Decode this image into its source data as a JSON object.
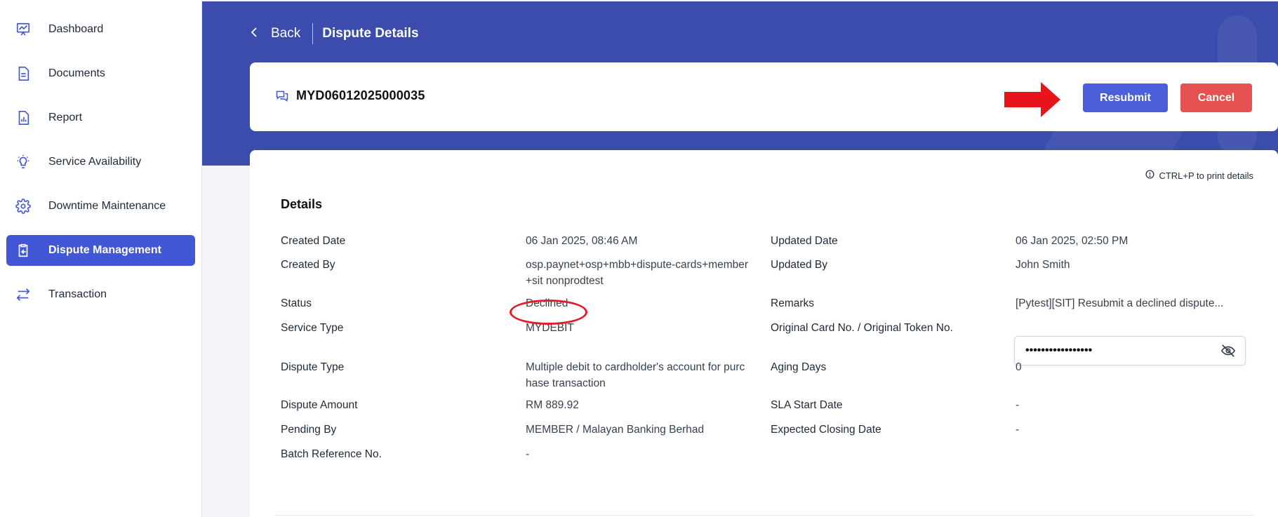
{
  "sidebar": {
    "items": [
      {
        "label": "Dashboard",
        "icon": "presentation-chart-icon"
      },
      {
        "label": "Documents",
        "icon": "document-icon"
      },
      {
        "label": "Report",
        "icon": "report-chart-icon"
      },
      {
        "label": "Service Availability",
        "icon": "lightbulb-icon"
      },
      {
        "label": "Downtime Maintenance",
        "icon": "gear-icon"
      },
      {
        "label": "Dispute Management",
        "icon": "clipboard-arrow-icon",
        "active": true
      },
      {
        "label": "Transaction",
        "icon": "arrows-exchange-icon"
      }
    ]
  },
  "header": {
    "back_label": "Back",
    "title": "Dispute Details"
  },
  "dispute": {
    "id": "MYD06012025000035",
    "resubmit_label": "Resubmit",
    "cancel_label": "Cancel"
  },
  "details": {
    "print_hint": "CTRL+P to print details",
    "title": "Details",
    "left": [
      {
        "label": "Created Date",
        "value": "06 Jan 2025, 08:46 AM"
      },
      {
        "label": "Created By",
        "value": "osp.paynet+osp+mbb+dispute-cards+member",
        "value2": "+sit nonprodtest"
      },
      {
        "label": "Status",
        "value": "Declined"
      },
      {
        "label": "Service Type",
        "value": "MYDEBIT"
      },
      {
        "label": "Dispute Type",
        "value": "Multiple debit to cardholder's account for purc",
        "value2": "hase transaction"
      },
      {
        "label": "Dispute Amount",
        "value": "RM 889.92"
      },
      {
        "label": "Pending By",
        "value": "MEMBER / Malayan Banking Berhad"
      },
      {
        "label": "Batch Reference No.",
        "value": "-"
      }
    ],
    "right": [
      {
        "label": "Updated Date",
        "value": "06 Jan 2025, 02:50 PM"
      },
      {
        "label": "Updated By",
        "value": "John Smith"
      },
      {
        "label": "Remarks",
        "value": "[Pytest][SIT] Resubmit a declined dispute..."
      },
      {
        "label": "Original Card No. / Original Token No.",
        "value": "•••••••••••••••••"
      },
      {
        "label": "Aging Days",
        "value": "0"
      },
      {
        "label": "SLA Start Date",
        "value": "-"
      },
      {
        "label": "Expected Closing Date",
        "value": "-"
      }
    ]
  },
  "colors": {
    "primary": "#4257d6",
    "header_band": "#3b4cac",
    "cancel": "#e55050",
    "annotation_red": "#e11d2a"
  }
}
